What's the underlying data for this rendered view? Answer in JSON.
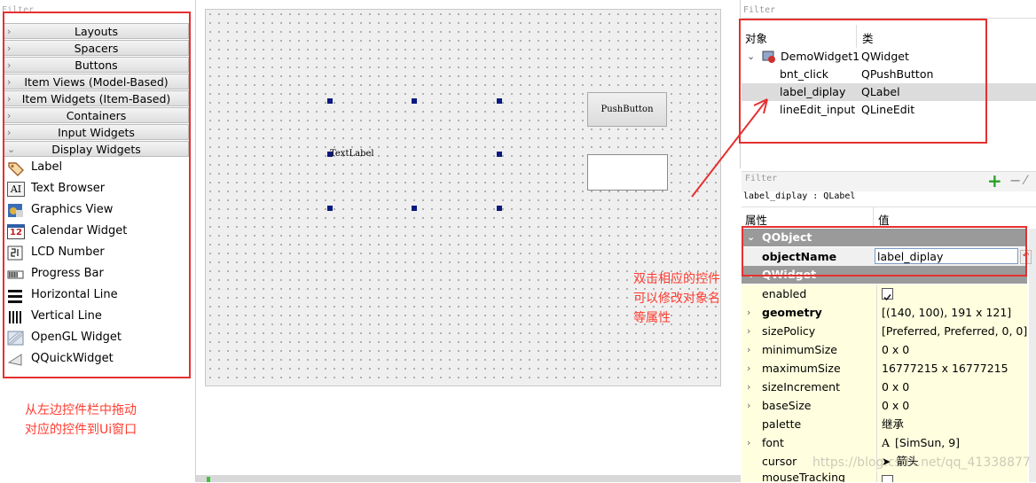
{
  "widget_box": {
    "filter_placeholder": "Filter",
    "categories": [
      "Layouts",
      "Spacers",
      "Buttons",
      "Item Views (Model-Based)",
      "Item Widgets (Item-Based)",
      "Containers",
      "Input Widgets",
      "Display Widgets"
    ],
    "items": [
      {
        "label": "Label",
        "icon": "label-tag-icon"
      },
      {
        "label": "Text Browser",
        "icon": "text-browser-icon"
      },
      {
        "label": "Graphics View",
        "icon": "graphics-view-icon"
      },
      {
        "label": "Calendar Widget",
        "icon": "calendar-icon"
      },
      {
        "label": "LCD Number",
        "icon": "lcd-number-icon"
      },
      {
        "label": "Progress Bar",
        "icon": "progress-bar-icon"
      },
      {
        "label": "Horizontal Line",
        "icon": "horizontal-line-icon"
      },
      {
        "label": "Vertical Line",
        "icon": "vertical-line-icon"
      },
      {
        "label": "OpenGL Widget",
        "icon": "opengl-widget-icon"
      },
      {
        "label": "QQuickWidget",
        "icon": "qquickwidget-icon"
      }
    ],
    "calendar_icon_text": "12",
    "text_browser_icon_text": "AI"
  },
  "form": {
    "text_label": "TextLabel",
    "push_button": "PushButton"
  },
  "object_inspector": {
    "filter_placeholder": "Filter",
    "col_object": "对象",
    "col_class": "类",
    "root": {
      "name": "DemoWidget1",
      "class": "QWidget"
    },
    "children": [
      {
        "name": "bnt_click",
        "class": "QPushButton"
      },
      {
        "name": "label_diplay",
        "class": "QLabel"
      },
      {
        "name": "lineEdit_input",
        "class": "QLineEdit"
      }
    ]
  },
  "property_editor": {
    "filter_placeholder": "Filter",
    "object_line": "label_diplay : QLabel",
    "col_property": "属性",
    "col_value": "值",
    "group_qobject": "QObject",
    "objectname_label": "objectName",
    "objectname_value": "label_diplay",
    "group_qwidget": "QWidget",
    "properties": [
      {
        "name": "enabled",
        "value": ""
      },
      {
        "name": "geometry",
        "value": "[(140, 100), 191 x 121]"
      },
      {
        "name": "sizePolicy",
        "value": "[Preferred, Preferred, 0, 0]"
      },
      {
        "name": "minimumSize",
        "value": "0 x 0"
      },
      {
        "name": "maximumSize",
        "value": "16777215 x 16777215"
      },
      {
        "name": "sizeIncrement",
        "value": "0 x 0"
      },
      {
        "name": "baseSize",
        "value": "0 x 0"
      },
      {
        "name": "palette",
        "value": "继承"
      },
      {
        "name": "font",
        "value": "[SimSun, 9]"
      },
      {
        "name": "cursor",
        "value": "箭头"
      },
      {
        "name": "mouseTracking",
        "value": ""
      }
    ],
    "font_glyph": "A"
  },
  "annotations": {
    "note_left_line1": "从左边控件栏中拖动",
    "note_left_line2": "对应的控件到Ui窗口",
    "note_right_line1": "双击相应的控件",
    "note_right_line2": "可以修改对象名",
    "note_right_line3": "等属性",
    "watermark": "https://blog.csdn.net/qq_41338877",
    "color": "#e53030"
  }
}
